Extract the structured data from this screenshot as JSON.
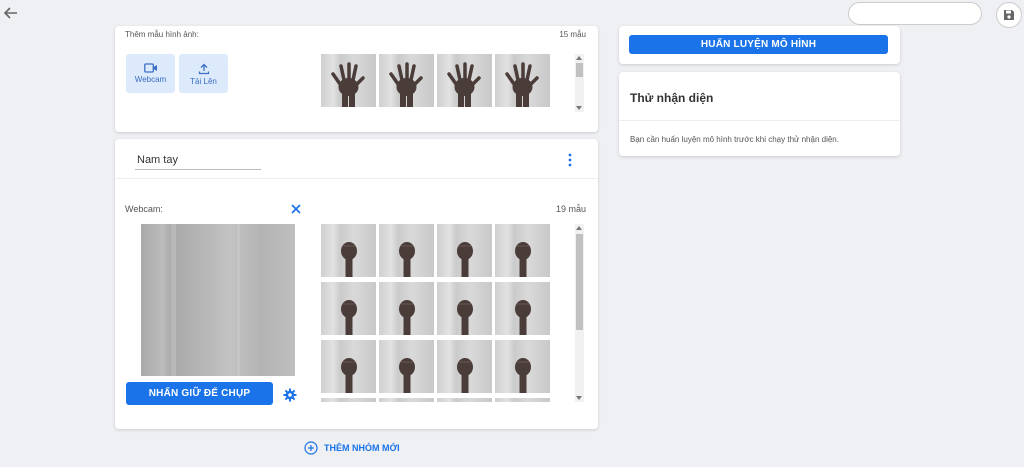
{
  "top": {
    "back_icon": "arrow-left-icon",
    "search_value": "",
    "save_icon": "floppy-disk-icon"
  },
  "class1": {
    "add_samples_label": "Thêm mẫu hình ảnh:",
    "sample_count": "15 mẫu",
    "webcam_label": "Webcam",
    "upload_label": "Tải Lên",
    "thumb_count": 4
  },
  "class2": {
    "name_value": "Nam tay",
    "webcam_label": "Webcam:",
    "sample_count": "19 mẫu",
    "capture_button": "NHẤN GIỮ ĐỂ CHỤP",
    "thumb_count": 16
  },
  "add_group": "THÊM NHÓM MỚI",
  "train_button": "HUẤN LUYỆN MÔ HÌNH",
  "preview": {
    "title": "Thử nhận diện",
    "message": "Bạn cần huấn luyện mô hình trước khi chạy thử nhận diện."
  },
  "colors": {
    "accent": "#1a73e8",
    "background": "#eef0f3"
  }
}
